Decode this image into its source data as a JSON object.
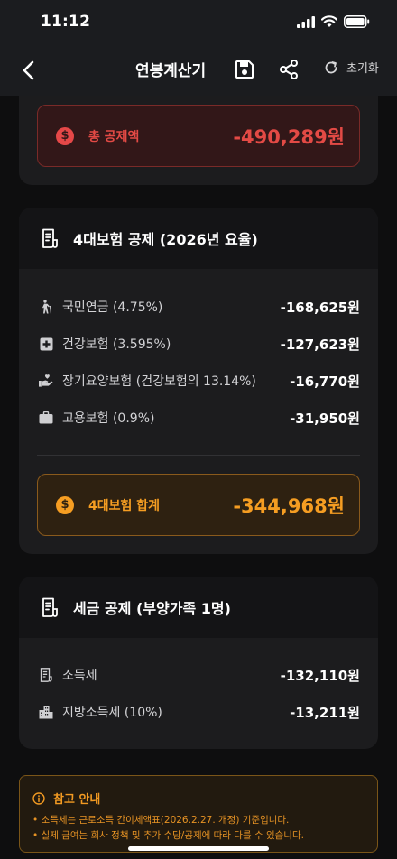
{
  "status_bar": {
    "time": "11:12"
  },
  "nav": {
    "title": "연봉계산기",
    "reset_label": "초기화",
    "icons": {
      "back": "chevron-left-icon",
      "save": "save-icon",
      "share": "share-icon",
      "reset": "refresh-icon"
    }
  },
  "total_deduction": {
    "label": "총 공제액",
    "value": "-490,289원",
    "color": "#e34a45"
  },
  "insurance": {
    "title": "4대보험 공제 (2026년 요율)",
    "items": [
      {
        "label": "국민연금 (4.75%)",
        "value": "-168,625원",
        "icon": "person-walking-icon"
      },
      {
        "label": "건강보험 (3.595%)",
        "value": "-127,623원",
        "icon": "medical-cross-icon"
      },
      {
        "label": "장기요양보험 (건강보험의 13.14%)",
        "value": "-16,770원",
        "icon": "care-hand-icon"
      },
      {
        "label": "고용보험 (0.9%)",
        "value": "-31,950원",
        "icon": "briefcase-icon"
      }
    ],
    "total": {
      "label": "4대보험 합계",
      "value": "-344,968원",
      "color": "#f59d22"
    }
  },
  "tax": {
    "title": "세금 공제 (부양가족 1명)",
    "items": [
      {
        "label": "소득세",
        "value": "-132,110원",
        "icon": "receipt-icon"
      },
      {
        "label": "지방소득세 (10%)",
        "value": "-13,211원",
        "icon": "buildings-icon"
      }
    ]
  },
  "notice": {
    "title": "참고 안내",
    "lines": [
      "• 소득세는 근로소득 간이세액표(2026.2.27. 개정) 기준입니다.",
      "• 실제 급여는 회사 정책 및 추가 수당/공제에 따라 다를 수 있습니다."
    ]
  }
}
